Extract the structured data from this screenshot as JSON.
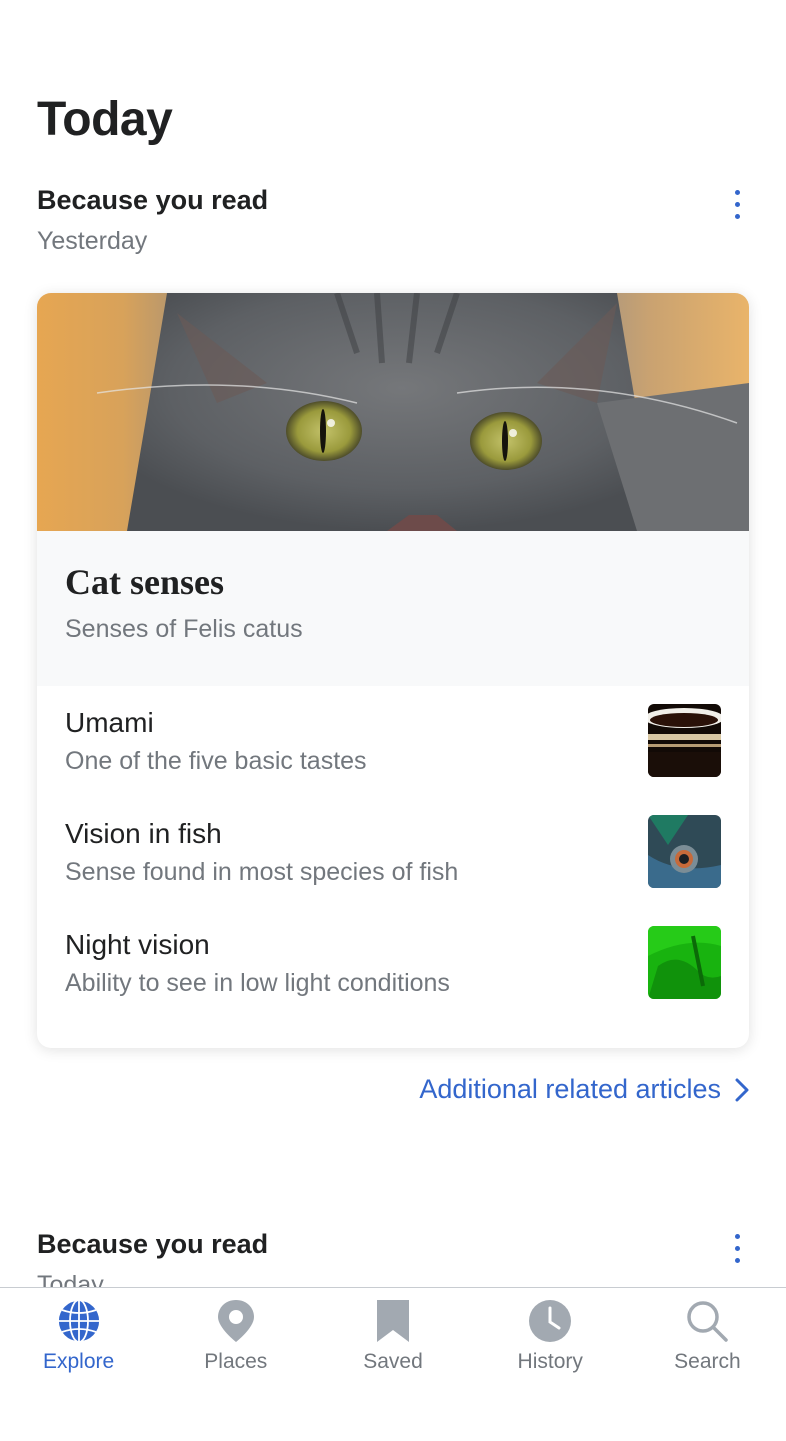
{
  "page": {
    "title": "Today"
  },
  "sections": [
    {
      "title": "Because you read",
      "subtitle": "Yesterday",
      "card": {
        "hero_title": "Cat senses",
        "hero_description": "Senses of Felis catus",
        "related": [
          {
            "title": "Umami",
            "description": "One of the five basic tastes"
          },
          {
            "title": "Vision in fish",
            "description": "Sense found in most species of fish"
          },
          {
            "title": "Night vision",
            "description": "Ability to see in low light conditions"
          }
        ]
      },
      "more_link": "Additional related articles"
    },
    {
      "title": "Because you read",
      "subtitle": "Today"
    }
  ],
  "tabbar": {
    "items": [
      {
        "label": "Explore",
        "icon": "globe-icon",
        "active": true
      },
      {
        "label": "Places",
        "icon": "map-pin-icon",
        "active": false
      },
      {
        "label": "Saved",
        "icon": "bookmark-icon",
        "active": false
      },
      {
        "label": "History",
        "icon": "clock-icon",
        "active": false
      },
      {
        "label": "Search",
        "icon": "search-icon",
        "active": false
      }
    ]
  },
  "colors": {
    "accent": "#3366cc",
    "text": "#202122",
    "secondary_text": "#72777d",
    "inactive_icon": "#a2a9b1"
  }
}
